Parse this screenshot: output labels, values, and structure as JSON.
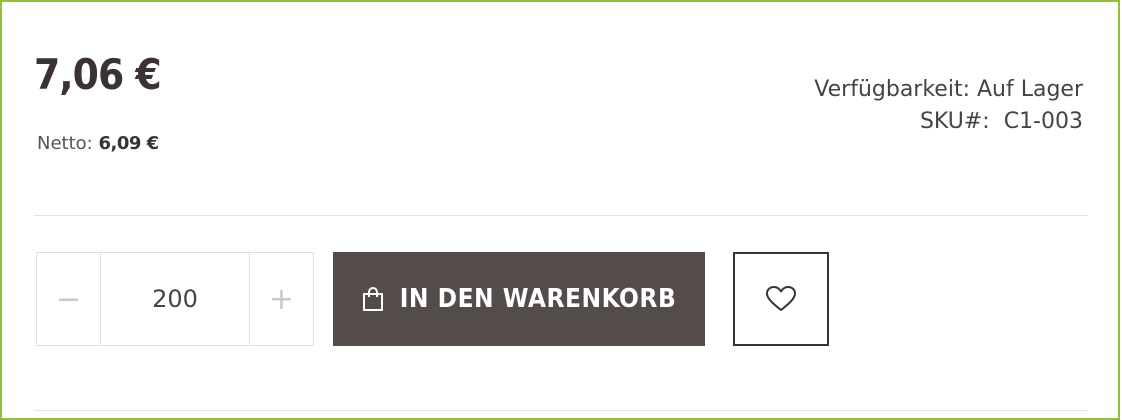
{
  "product": {
    "price": "7,06 €",
    "netto_label": "Netto:",
    "netto_value": "6,09 €",
    "availability": "Verfügbarkeit: Auf Lager",
    "sku_label": "SKU#:",
    "sku_value": "C1-003"
  },
  "quantity": {
    "minus_label": "−",
    "value": "200",
    "plus_label": "+"
  },
  "actions": {
    "add_to_cart_label": "IN DEN WARENKORB",
    "cart_icon": "shopping-bag-icon",
    "wishlist_icon": "heart-icon"
  },
  "colors": {
    "frame_border": "#94bf3a",
    "button_background": "#544c4a",
    "button_text": "#ffffff",
    "price_text": "#3a3332"
  }
}
